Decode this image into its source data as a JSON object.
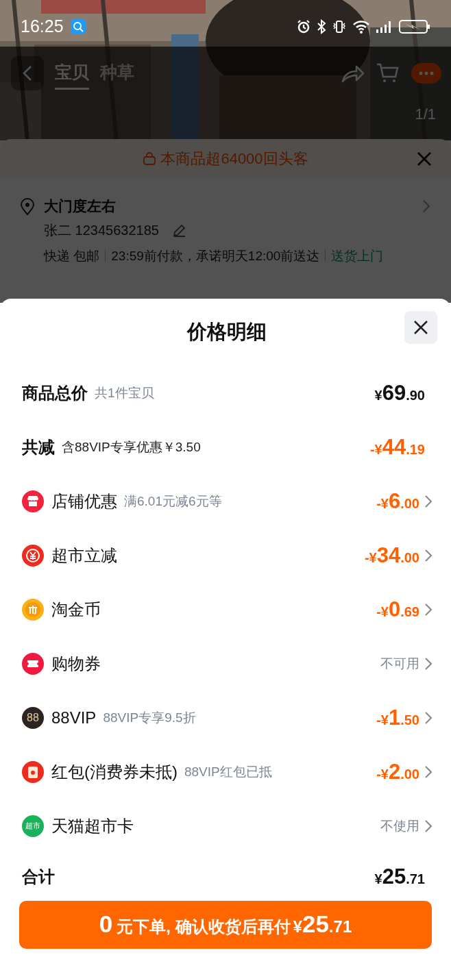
{
  "status_bar": {
    "time": "16:25"
  },
  "nav": {
    "tabs": [
      {
        "label": "宝贝",
        "selected": true
      },
      {
        "label": "种草",
        "selected": false
      }
    ],
    "counter": "1/1"
  },
  "order": {
    "banner": "本商品超64000回头客",
    "address": "大门度左右",
    "contact": "张二  12345632185",
    "delivery": {
      "method": "快递 包邮",
      "promise": "23:59前付款，承诺明天12:00前送达",
      "service": "送货上门"
    }
  },
  "sheet": {
    "title": "价格明细",
    "rows": [
      {
        "kind": "summary",
        "label": "商品总价",
        "note": "共1件宝贝",
        "value": {
          "sign": "¥",
          "int": "69",
          "dec": ".90"
        },
        "discount": false
      },
      {
        "kind": "summary",
        "label": "共减",
        "note": "含88VIP专享优惠￥3.50",
        "value": {
          "sign": "-¥",
          "int": "44",
          "dec": ".19"
        },
        "discount": true
      },
      {
        "kind": "item",
        "label": "店铺优惠",
        "note": "满6.01元减6元等",
        "value": {
          "sign": "-¥",
          "int": "6",
          "dec": ".00"
        },
        "discount": true
      },
      {
        "kind": "item",
        "label": "超市立减",
        "value": {
          "sign": "-¥",
          "int": "34",
          "dec": ".00"
        },
        "discount": true
      },
      {
        "kind": "item",
        "label": "淘金币",
        "value": {
          "sign": "-¥",
          "int": "0",
          "dec": ".69"
        },
        "discount": true
      },
      {
        "kind": "item",
        "label": "购物券",
        "status": "不可用"
      },
      {
        "kind": "item",
        "icon_text": "88",
        "label": "88VIP",
        "note": "88VIP专享9.5折",
        "value": {
          "sign": "-¥",
          "int": "1",
          "dec": ".50"
        },
        "discount": true
      },
      {
        "kind": "item",
        "label": "红包(消费券未抵)",
        "note": "88VIP红包已抵",
        "value": {
          "sign": "-¥",
          "int": "2",
          "dec": ".00"
        },
        "discount": true
      },
      {
        "kind": "item",
        "icon_text": "超市",
        "label": "天猫超市卡",
        "status": "不使用"
      },
      {
        "kind": "total",
        "label": "合计",
        "value": {
          "sign": "¥",
          "int": "25",
          "dec": ".71"
        },
        "discount": false
      }
    ],
    "button": {
      "lead": "0",
      "text": "元下单, 确认收货后再付",
      "value": {
        "sign": "¥",
        "int": "25",
        "dec": ".71"
      }
    }
  }
}
